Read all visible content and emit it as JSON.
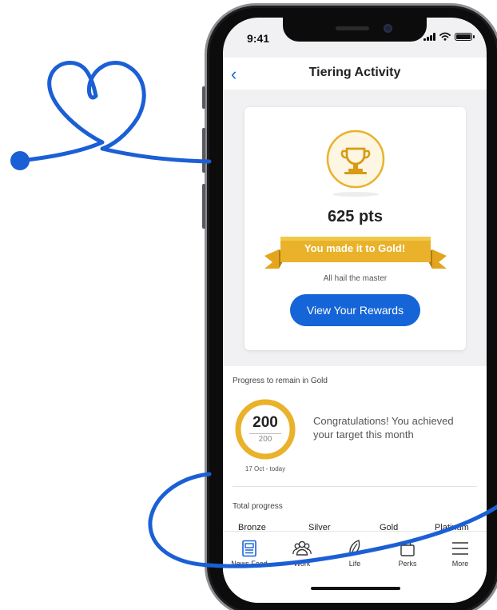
{
  "status_bar": {
    "time": "9:41"
  },
  "header": {
    "title": "Tiering Activity",
    "back_icon": "chevron-left-icon"
  },
  "tier_card": {
    "trophy_icon": "trophy-icon",
    "points": "625 pts",
    "ribbon_text": "You made it to Gold!",
    "tagline": "All hail the master",
    "cta_label": "View Your Rewards"
  },
  "progress": {
    "label": "Progress to remain in Gold",
    "current": "200",
    "target": "200",
    "fraction": 1.0,
    "date_range": "17 Oct - today",
    "message": "Congratulations! You achieved your target this month"
  },
  "total_progress": {
    "label": "Total progress",
    "tiers": [
      "Bronze",
      "Silver",
      "Gold",
      "Platinum"
    ]
  },
  "tabbar": {
    "items": [
      {
        "label": "News Feed",
        "icon": "news-feed-icon"
      },
      {
        "label": "Work",
        "icon": "people-icon"
      },
      {
        "label": "Life",
        "icon": "leaf-icon"
      },
      {
        "label": "Perks",
        "icon": "shopping-bag-icon"
      },
      {
        "label": "More",
        "icon": "menu-icon"
      }
    ]
  },
  "colors": {
    "accent_blue": "#1565d8",
    "gold": "#e9b22a",
    "gold_dark": "#d99a14",
    "scribble": "#1b5fd6"
  }
}
